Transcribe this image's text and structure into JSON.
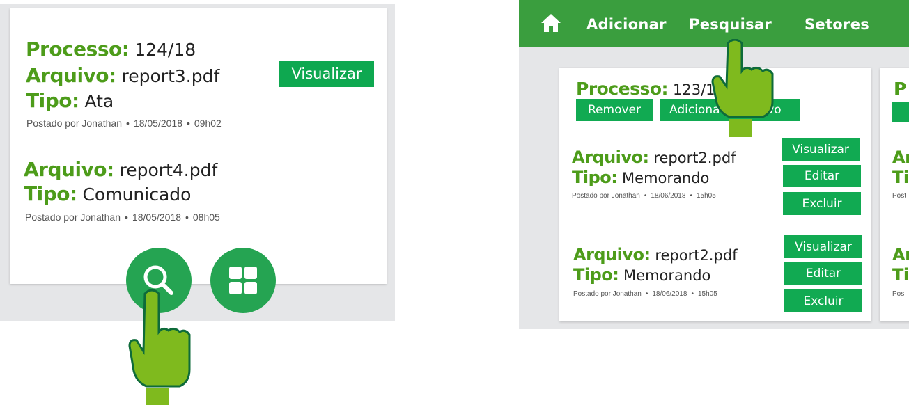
{
  "colors": {
    "green_label": "#4d9c1a",
    "button_green": "#0ea850",
    "nav_green": "#3a9e3e",
    "hand_green": "#7fba1e"
  },
  "left": {
    "process": {
      "label": "Processo:",
      "value": "124/18"
    },
    "items": [
      {
        "file_label": "Arquivo:",
        "file": "report3.pdf",
        "type_label": "Tipo:",
        "type": "Ata",
        "meta": {
          "by": "Postado por Jonathan",
          "date": "18/05/2018",
          "time": "09h02"
        }
      },
      {
        "file_label": "Arquivo:",
        "file": "report4.pdf",
        "type_label": "Tipo:",
        "type": "Comunicado",
        "meta": {
          "by": "Postado por Jonathan",
          "date": "18/05/2018",
          "time": "08h05"
        }
      }
    ],
    "view_button": "Visualizar",
    "fabs": {
      "search_icon": "search-icon",
      "grid_icon": "grid-icon"
    }
  },
  "right": {
    "nav": {
      "home_icon": "home-icon",
      "items": [
        "Adicionar",
        "Pesquisar",
        "Setores"
      ]
    },
    "process": {
      "label": "Processo:",
      "value": "123/18"
    },
    "process_buttons": {
      "remove": "Remover",
      "add": "Adicionar",
      "add_tail": "ivo"
    },
    "items": [
      {
        "file_label": "Arquivo:",
        "file": "report2.pdf",
        "type_label": "Tipo:",
        "type": "Memorando",
        "meta": {
          "by": "Postado por Jonathan",
          "date": "18/06/2018",
          "time": "15h05"
        },
        "buttons": [
          "Visualizar",
          "Editar",
          "Excluir"
        ]
      },
      {
        "file_label": "Arquivo:",
        "file": "report2.pdf",
        "type_label": "Tipo:",
        "type": "Memorando",
        "meta": {
          "by": "Postado por Jonathan",
          "date": "18/06/2018",
          "time": "15h05"
        },
        "buttons": [
          "Visualizar",
          "Editar",
          "Excluir"
        ]
      }
    ],
    "clipped": {
      "p": "P",
      "ar": "Ar",
      "ti": "Ti",
      "post": "Post",
      "ar2": "Ar",
      "ti2": "Ti",
      "pos": "Pos"
    }
  }
}
